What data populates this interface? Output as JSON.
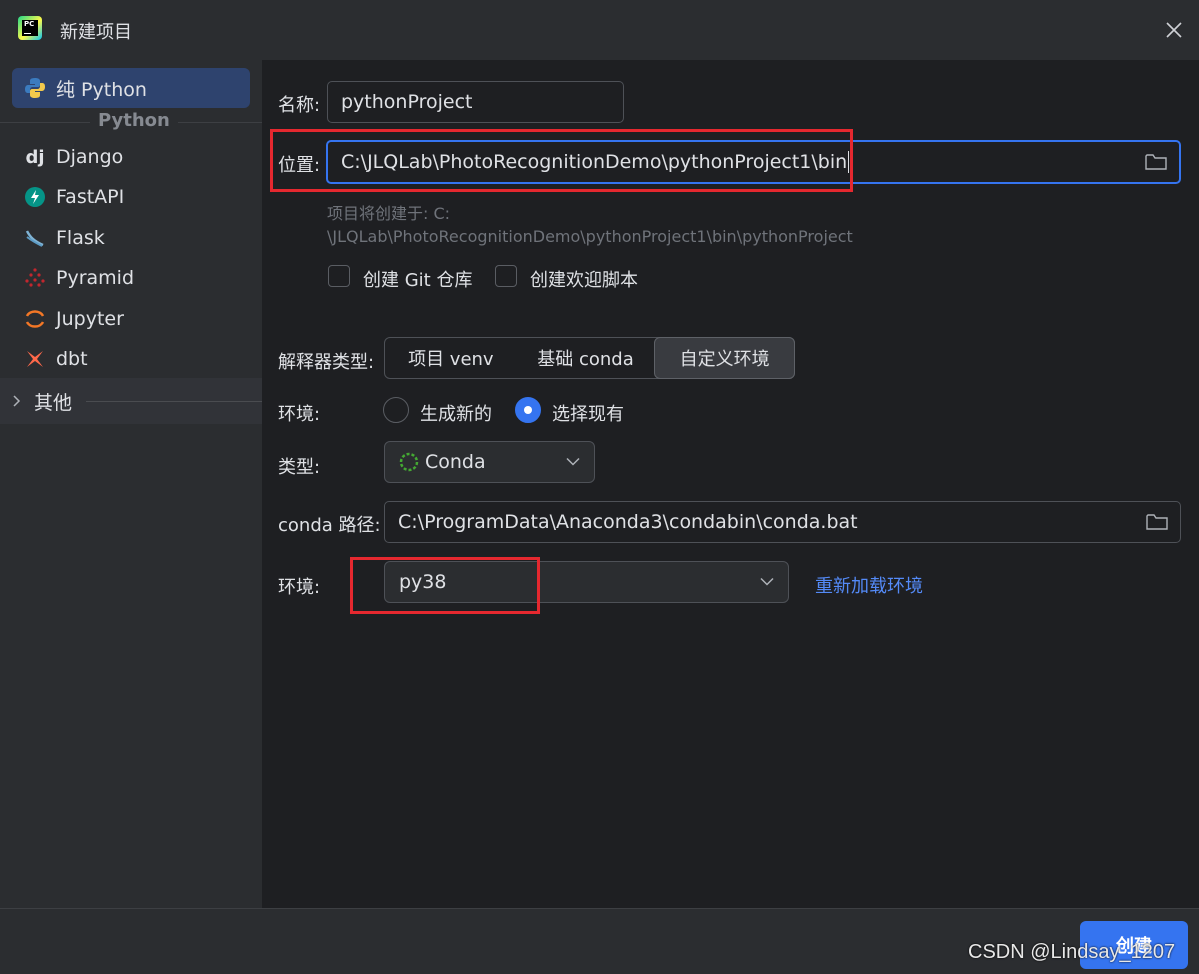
{
  "window": {
    "title": "新建项目"
  },
  "sidebar": {
    "items": [
      {
        "label": "纯 Python",
        "icon": "python-icon",
        "selected": true
      },
      {
        "label": "Django",
        "icon": "django-icon"
      },
      {
        "label": "FastAPI",
        "icon": "fastapi-icon"
      },
      {
        "label": "Flask",
        "icon": "flask-icon"
      },
      {
        "label": "Pyramid",
        "icon": "pyramid-icon"
      },
      {
        "label": "Jupyter",
        "icon": "jupyter-icon"
      },
      {
        "label": "dbt",
        "icon": "dbt-icon"
      }
    ],
    "group_label": "Python",
    "other_label": "其他"
  },
  "form": {
    "name_label": "名称:",
    "name_value": "pythonProject",
    "location_label": "位置:",
    "location_value": "C:\\JLQLab\\PhotoRecognitionDemo\\pythonProject1\\bin",
    "hint_line1": "项目将创建于: C:",
    "hint_line2": "\\JLQLab\\PhotoRecognitionDemo\\pythonProject1\\bin\\pythonProject",
    "git_label": "创建 Git 仓库",
    "welcome_label": "创建欢迎脚本",
    "interpreter_type_label": "解释器类型:",
    "interpreter_types": [
      "项目 venv",
      "基础 conda",
      "自定义环境"
    ],
    "interpreter_selected": "自定义环境",
    "env_label": "环境:",
    "env_options": [
      "生成新的",
      "选择现有"
    ],
    "env_selected": "选择现有",
    "type_label": "类型:",
    "type_value": "Conda",
    "conda_path_label": "conda 路径:",
    "conda_path_value": "C:\\ProgramData\\Anaconda3\\condabin\\conda.bat",
    "env2_label": "环境:",
    "env2_value": "py38",
    "reload_link": "重新加载环境"
  },
  "footer": {
    "create_label": "创建",
    "watermark": "CSDN @Lindsay_1207"
  },
  "colors": {
    "accent": "#3574f0",
    "highlight_box": "#e5282f",
    "link": "#548af7"
  }
}
